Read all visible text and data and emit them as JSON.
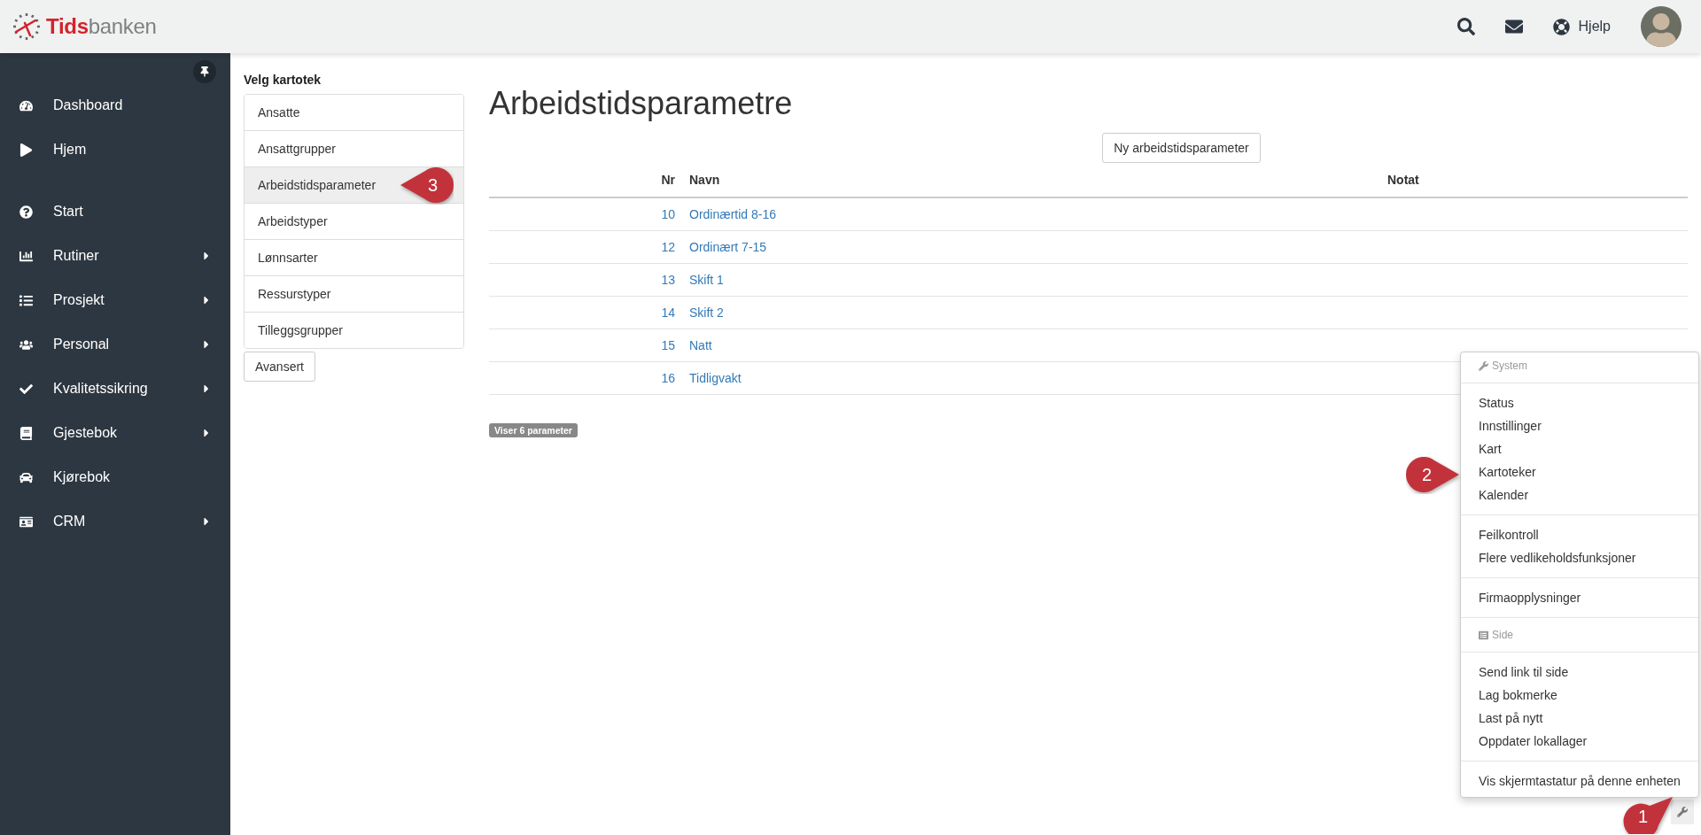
{
  "header": {
    "logo": {
      "first": "Tids",
      "second": "banken"
    },
    "help": "Hjelp"
  },
  "sidebar": {
    "sections": [
      [
        {
          "label": "Dashboard",
          "submenu": false
        },
        {
          "label": "Hjem",
          "submenu": false
        }
      ],
      [
        {
          "label": "Start",
          "submenu": false
        },
        {
          "label": "Rutiner",
          "submenu": true
        },
        {
          "label": "Prosjekt",
          "submenu": true
        },
        {
          "label": "Personal",
          "submenu": true
        },
        {
          "label": "Kvalitetssikring",
          "submenu": true
        },
        {
          "label": "Gjestebok",
          "submenu": true
        },
        {
          "label": "Kjørebok",
          "submenu": false
        },
        {
          "label": "CRM",
          "submenu": true
        }
      ]
    ]
  },
  "kartotek": {
    "title": "Velg kartotek",
    "items": [
      {
        "label": "Ansatte",
        "selected": false
      },
      {
        "label": "Ansattgrupper",
        "selected": false
      },
      {
        "label": "Arbeidstidsparameter",
        "selected": true
      },
      {
        "label": "Arbeidstyper",
        "selected": false
      },
      {
        "label": "Lønnsarter",
        "selected": false
      },
      {
        "label": "Ressurstyper",
        "selected": false
      },
      {
        "label": "Tilleggsgrupper",
        "selected": false
      }
    ],
    "advanced_button": "Avansert"
  },
  "main": {
    "title": "Arbeidstidsparametre",
    "new_button": "Ny arbeidstidsparameter",
    "table": {
      "columns": [
        "Nr",
        "Navn",
        "Notat"
      ],
      "rows": [
        {
          "nr": "10",
          "name": "Ordinærtid 8-16"
        },
        {
          "nr": "12",
          "name": "Ordinært 7-15"
        },
        {
          "nr": "13",
          "name": "Skift 1"
        },
        {
          "nr": "14",
          "name": "Skift 2"
        },
        {
          "nr": "15",
          "name": "Natt"
        },
        {
          "nr": "16",
          "name": "Tidligvakt"
        }
      ]
    },
    "count_badge": "Viser 6 parameter"
  },
  "system_menu": {
    "groups": [
      {
        "kind": "heading",
        "label": "System"
      },
      {
        "kind": "links",
        "items": [
          "Status",
          "Innstillinger",
          "Kart",
          "Kartoteker",
          "Kalender"
        ]
      },
      {
        "kind": "links",
        "items": [
          "Feilkontroll",
          "Flere vedlikeholdsfunksjoner"
        ]
      },
      {
        "kind": "links",
        "items": [
          "Firmaopplysninger"
        ]
      },
      {
        "kind": "heading",
        "label": "Side"
      },
      {
        "kind": "links",
        "items": [
          "Send link til side",
          "Lag bokmerke",
          "Last på nytt",
          "Oppdater lokallager"
        ]
      },
      {
        "kind": "links",
        "items": [
          "Vis skjermtastatur på denne enheten"
        ]
      }
    ]
  },
  "callouts": [
    "1",
    "2",
    "3"
  ]
}
